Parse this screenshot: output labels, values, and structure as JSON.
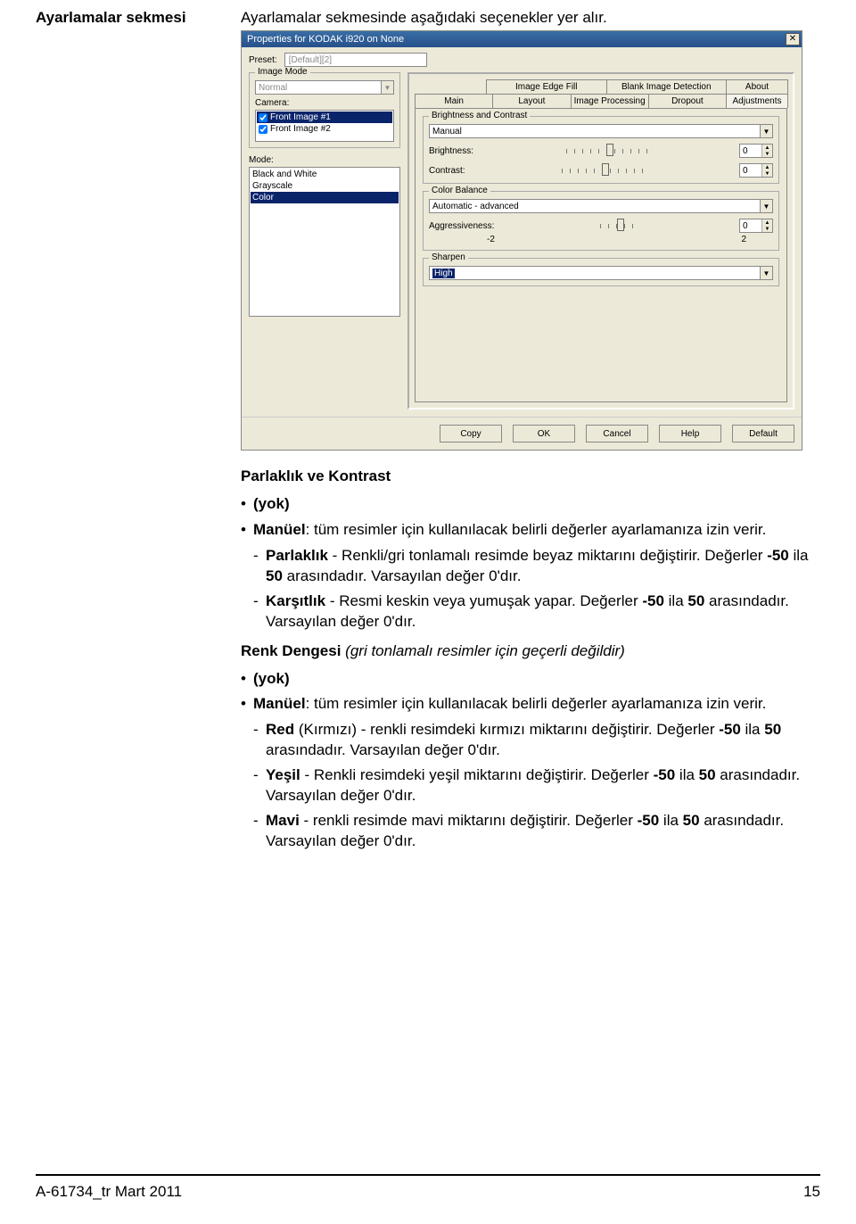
{
  "doc": {
    "section_title": "Ayarlamalar sekmesi",
    "intro": "Ayarlamalar sekmesinde aşağıdaki seçenekler yer alır.",
    "bc_heading": "Parlaklık ve Kontrast",
    "bullet_none": "(yok)",
    "bullet_manual_prefix": "Manüel",
    "bullet_manual_rest": ": tüm resimler için kullanılacak belirli değerler ayarlamanıza izin verir.",
    "dash_brightness_prefix": "Parlaklık",
    "dash_brightness_txt1": " - Renkli/gri tonlamalı resimde beyaz miktarını değiştirir. Değerler ",
    "dash_brightness_range_a": "-50",
    "dash_brightness_txt2": " ila ",
    "dash_brightness_range_b": "50",
    "dash_brightness_txt3": " arasındadır. Varsayılan değer 0'dır.",
    "dash_contrast_prefix": "Karşıtlık",
    "dash_contrast_txt1": " - Resmi keskin veya yumuşak yapar. Değerler ",
    "dash_contrast_range_a": "-50",
    "dash_contrast_txt2": " ila ",
    "dash_contrast_range_b": "50",
    "dash_contrast_txt3": " arasındadır. Varsayılan değer 0'dır.",
    "cb_heading": "Renk Dengesi",
    "cb_note": " (gri tonlamalı resimler için geçerli değildir)",
    "dash_red_prefix": "Red",
    "dash_red_txt1": " (Kırmızı) - renkli resimdeki kırmızı miktarını değiştirir. Değerler ",
    "dash_red_range_a": "-50",
    "dash_red_txt2": " ila ",
    "dash_red_range_b": "50",
    "dash_red_txt3": " arasındadır. Varsayılan değer 0'dır.",
    "dash_green_prefix": "Yeşil",
    "dash_green_txt1": " - Renkli resimdeki yeşil miktarını değiştirir. Değerler ",
    "dash_green_range_a": "-50",
    "dash_green_txt2": " ila ",
    "dash_green_range_b": "50",
    "dash_green_txt3": " arasındadır. Varsayılan değer 0'dır.",
    "dash_blue_prefix": "Mavi",
    "dash_blue_txt1": " - renkli resimde mavi miktarını değiştirir. Değerler ",
    "dash_blue_range_a": "-50",
    "dash_blue_txt2": " ila ",
    "dash_blue_range_b": "50",
    "dash_blue_txt3": " arasındadır. Varsayılan değer 0'dır.",
    "footer_left": "A-61734_tr  Mart 2011",
    "footer_right": "15"
  },
  "dlg": {
    "title": "Properties for KODAK i920 on None",
    "preset_label": "Preset:",
    "preset_value": "[Default][2]",
    "image_mode_legend": "Image Mode",
    "image_mode_value": "Normal",
    "camera_label": "Camera:",
    "camera_items": [
      "Front Image #1",
      "Front Image #2"
    ],
    "mode_label": "Mode:",
    "mode_items": [
      "Black and White",
      "Grayscale",
      "Color"
    ],
    "tabs_top": [
      "Image Edge Fill",
      "Blank Image Detection",
      "About"
    ],
    "tabs_bottom": [
      "Main",
      "Layout",
      "Image Processing",
      "Dropout",
      "Adjustments"
    ],
    "bc_legend": "Brightness and Contrast",
    "bc_mode": "Manual",
    "brightness_label": "Brightness:",
    "brightness_value": "0",
    "contrast_label": "Contrast:",
    "contrast_value": "0",
    "cb_legend": "Color Balance",
    "cb_mode": "Automatic - advanced",
    "aggr_label": "Aggressiveness:",
    "aggr_value": "0",
    "axis_min": "-2",
    "axis_max": "2",
    "sharpen_legend": "Sharpen",
    "sharpen_value": "High",
    "buttons": [
      "Copy",
      "OK",
      "Cancel",
      "Help",
      "Default"
    ]
  }
}
